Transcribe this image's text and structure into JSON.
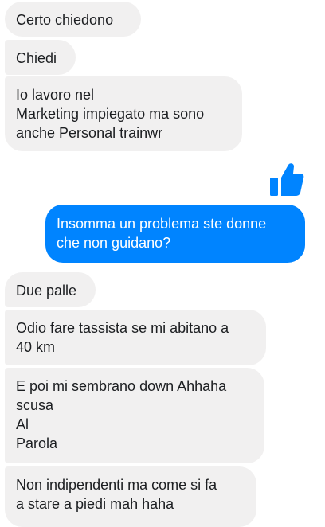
{
  "conversation": {
    "messages": [
      {
        "sender": "them",
        "text": "Certo chiedono"
      },
      {
        "sender": "them",
        "text": "Chiedi"
      },
      {
        "sender": "them",
        "text": "Io lavoro nel\nMarketing impiegato ma sono\nanche Personal trainwr"
      },
      {
        "sender": "me",
        "type": "like",
        "icon": "thumbs-up-icon"
      },
      {
        "sender": "me",
        "text": "Insomma un problema ste donne\nche non guidano?"
      },
      {
        "sender": "them",
        "text": "Due palle"
      },
      {
        "sender": "them",
        "text": "Odio fare tassista se mi abitano a\n40 km"
      },
      {
        "sender": "them",
        "text": "E poi mi sembrano down Ahhaha\nscusa\nAl\nParola"
      },
      {
        "sender": "them",
        "text": "Non indipendenti ma come si fa\na stare a piedi mah haha"
      }
    ]
  },
  "colors": {
    "incoming_bubble": "#f1f0f0",
    "outgoing_bubble": "#0084ff",
    "like_icon": "#0084ff",
    "text_dark": "#1c1e21",
    "text_light": "#ffffff"
  }
}
